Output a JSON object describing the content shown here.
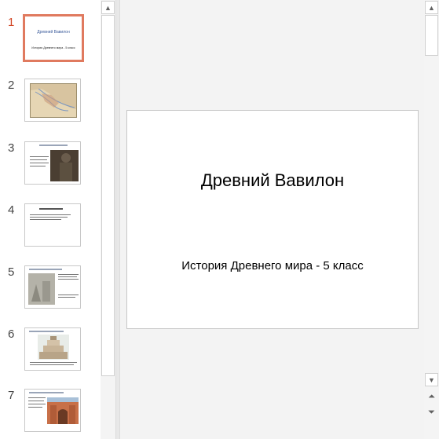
{
  "thumbnails": [
    {
      "number": "1",
      "title": "Древний Вавилон",
      "subtitle": "История Древнего мира - 5 класс",
      "selected": true
    },
    {
      "number": "2"
    },
    {
      "number": "3"
    },
    {
      "number": "4"
    },
    {
      "number": "5"
    },
    {
      "number": "6"
    },
    {
      "number": "7"
    }
  ],
  "slide": {
    "title": "Древний Вавилон",
    "subtitle": "История Древнего мира - 5 класс"
  },
  "colors": {
    "accent": "#d24726",
    "selected_border": "#e07a5f",
    "workspace": "#f3f3f3"
  },
  "icons": {
    "scroll_up": "▲",
    "scroll_down": "▼",
    "prev_slide": "⏶",
    "next_slide": "⏷"
  }
}
